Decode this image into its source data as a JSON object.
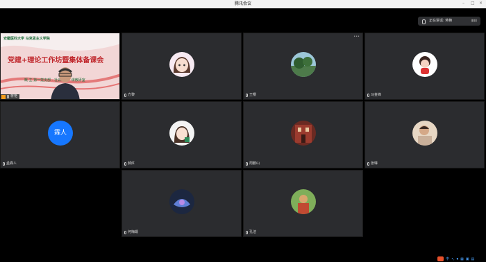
{
  "window": {
    "title": "腾讯会议"
  },
  "speaking": {
    "label": "正在讲话: 蒋艳"
  },
  "video_tile": {
    "name": "蒋艳",
    "logo": "安徽医科大学 马克思主义学院",
    "banner_title": "党建+理论工作坊暨集体备课会",
    "subtitle": "概 主 第一党支部 · 社会思想 · 课教研室"
  },
  "tiles": [
    {
      "name": "方黎",
      "avatar": "anime-girl-avatar"
    },
    {
      "name": "王樱",
      "avatar": "landscape-avatar"
    },
    {
      "name": "马金锋",
      "avatar": "cartoon-doll-avatar"
    },
    {
      "name": "孟霖人",
      "avatar_text": "霖人",
      "avatar": "blue-initial-avatar"
    },
    {
      "name": "郝红",
      "avatar": "anime-girl-2-avatar"
    },
    {
      "name": "周鹏山",
      "avatar": "building-avatar"
    },
    {
      "name": "张琳",
      "avatar": "child-photo-avatar"
    },
    {
      "name": "何梅娟",
      "avatar": "glass-art-avatar"
    },
    {
      "name": "孔洁",
      "avatar": "photo-avatar"
    }
  ],
  "taskbar": {
    "ime": "中"
  },
  "colors": {
    "tile_bg": "#2b2c2f",
    "accent": "#1677ff",
    "banner_red": "#c0282d"
  }
}
